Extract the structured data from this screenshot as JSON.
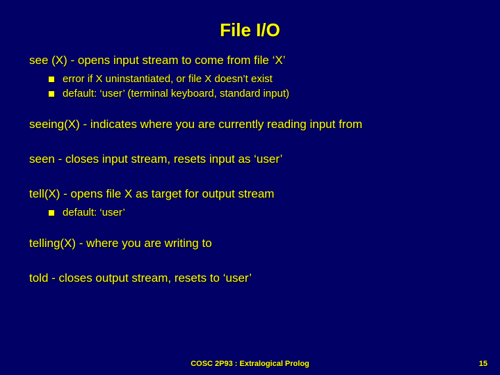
{
  "title": "File I/O",
  "lines": {
    "see": "see (X) - opens input stream to come from file ‘X’",
    "see_sub1": "error if X uninstantiated, or file X doesn’t exist",
    "see_sub2": "default: ‘user’ (terminal keyboard, standard input)",
    "seeing": "seeing(X) - indicates where you are currently reading input from",
    "seen": "seen  - closes input stream, resets input as ‘user’",
    "tell": "tell(X) - opens file X as target for output stream",
    "tell_sub1": "default: ‘user’",
    "telling": "telling(X)  - where you are writing to",
    "told": "told - closes output stream, resets to ‘user’"
  },
  "footer": "COSC 2P93 : Extralogical Prolog",
  "pagenum": "15"
}
